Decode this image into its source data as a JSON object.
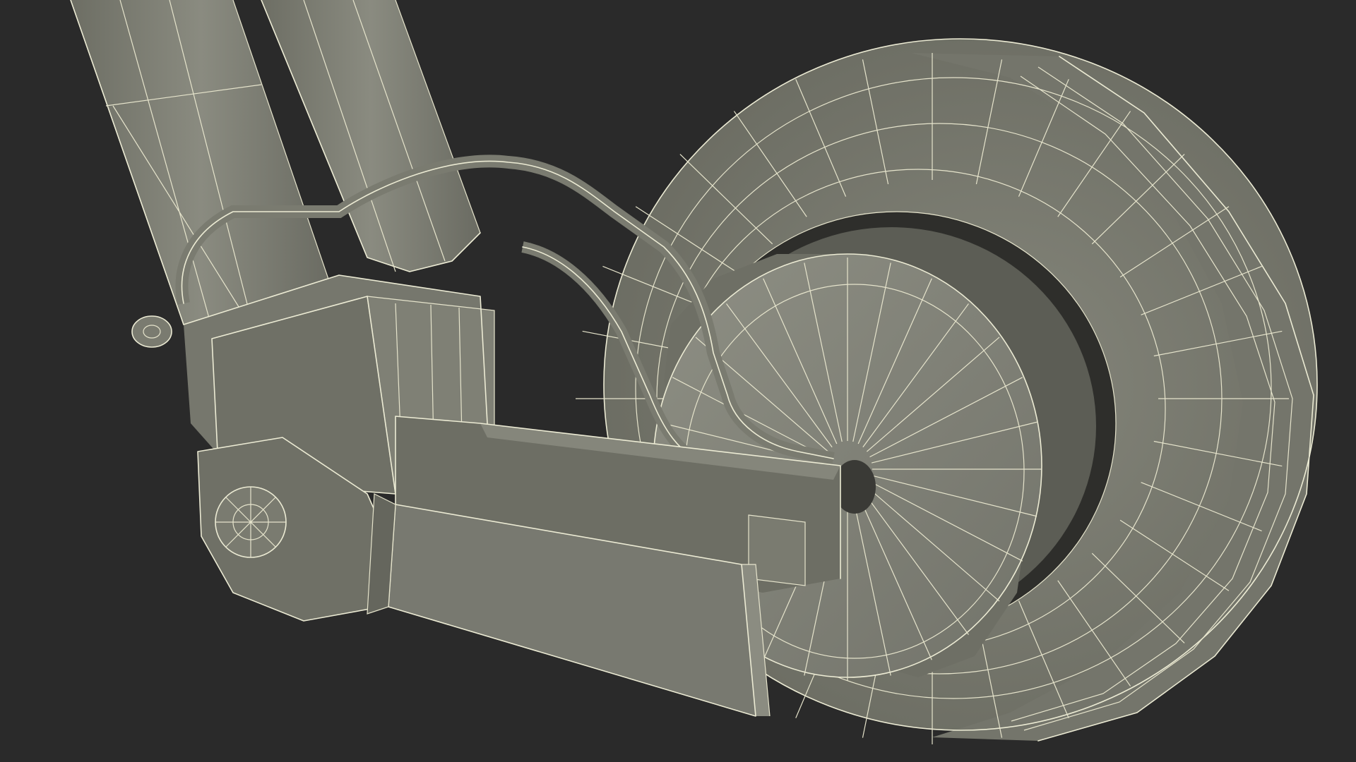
{
  "scene": {
    "subject": "",
    "background_color": "#2a2a2a",
    "surface_color": "#7a7b70",
    "surface_dark": "#5f6057",
    "surface_light": "#8c8d82",
    "wire_color": "#ecebd4"
  }
}
